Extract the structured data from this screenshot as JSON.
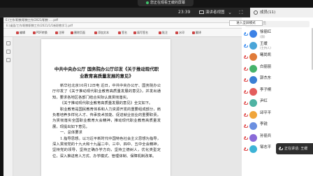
{
  "watch_banner": {
    "text": "您正在观看王缓的屏幕"
  },
  "meeting_bar": {
    "clock": "23:39",
    "speaker_view": "演讲者视图",
    "members_title": "成员(11)",
    "fullscreen_tip": "进入全屏模式"
  },
  "pdf": {
    "tab": "E:/工作/职教/职教工作/2021/职教 ... .pdf",
    "path": "E:/桌面/工作/职教职教工作/2021/1/1新职教学习.pdf",
    "tools": [
      "编辑",
      "PDF转换",
      "注释",
      "删除页面",
      "添加文本",
      "签名",
      "填写签名",
      "批注",
      "水印",
      "翻译"
    ],
    "title": "中共中央办公厅 国务院办公厅印发《关于推动现代职业教育高质量发展的意见》",
    "paragraphs": [
      "新华社北京10月12日电 近日，中共中央办公厅、国务院办公厅印发了《关于推动现代职业教育高质量发展的意见》，并发出通知，要求各地区各部门结合实际认真贯彻落实。",
      "《关于推动现代职业教育高质量发展的意见》全文如下。",
      "职业教育是国民教育体系和人力资源开发的重要组成部分，肩负着培养多样化人才、传承技术技能、促进就业创业的重要职责。为贯彻落实全国职业教育大会精神，推动现代职业教育高质量发展，现提出如下意见。",
      "一、总体要求",
      "1.指导思想。以习近平新时代中国特色社会主义思想为指导，深入贯彻党的十九大和十九届二中、三中、四中、五中全会精神，坚持党的领导，坚持正确办学方向，坚持立德树人，优化类型定位，深入推进育人方式、办学模式、管理体制、保障机制改革。"
    ]
  },
  "members_panel": {
    "search_placeholder": "搜索成员",
    "members": [
      {
        "name": "徐丽红",
        "role": "(我)",
        "color": "#3c82e6",
        "mic": "on"
      },
      {
        "name": "王缓",
        "role": "(主持人)",
        "color": "#4aa5d8",
        "mic": "on"
      },
      {
        "name": "曦尚凯",
        "role": "",
        "color": "#e07b39",
        "mic": "off"
      },
      {
        "name": "白丽丽",
        "role": "",
        "color": "#45b36b",
        "mic": "off"
      },
      {
        "name": "郭杰东",
        "role": "",
        "color": "#3a7fd4",
        "mic": "off"
      },
      {
        "name": "李子桐",
        "role": "",
        "color": "#e35d5d",
        "mic": "off"
      },
      {
        "name": "尹红",
        "role": "",
        "color": "#4fb3a3",
        "mic": "off"
      },
      {
        "name": "邱平平",
        "role": "",
        "color": "#f0a53b",
        "mic": "off"
      },
      {
        "name": "李锐",
        "role": "",
        "color": "#6b8fe0",
        "mic": "off"
      },
      {
        "name": "孙丽兵",
        "role": "",
        "color": "#8a6ad8",
        "mic": "off"
      },
      {
        "name": "邹志平",
        "role": "",
        "color": "#3db3d6",
        "mic": "off"
      }
    ]
  },
  "speaking_indicator": {
    "text": "正在讲话: 王缓"
  }
}
